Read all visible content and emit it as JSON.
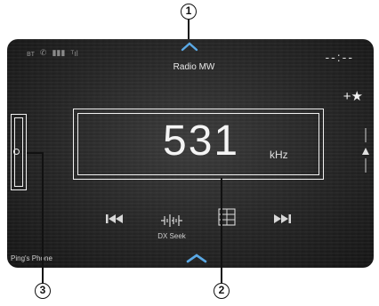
{
  "callouts": {
    "c1": "1",
    "c2": "2",
    "c3": "3"
  },
  "header": {
    "title": "Radio MW",
    "clock": "--:--"
  },
  "favorite": {
    "label": "+★"
  },
  "frequency": {
    "value": "531",
    "unit": "kHz"
  },
  "controls": {
    "dx_seek_label": "DX Seek"
  },
  "device": {
    "name": "Ping's Phone"
  },
  "colors": {
    "screen_bg": "#242424",
    "text": "#f0f0f0"
  },
  "icons": [
    "bluetooth-icon",
    "phone-icon",
    "battery-icon",
    "signal-icon",
    "star-icon",
    "prev-track-icon",
    "dx-seek-icon",
    "preset-list-icon",
    "next-track-icon"
  ]
}
